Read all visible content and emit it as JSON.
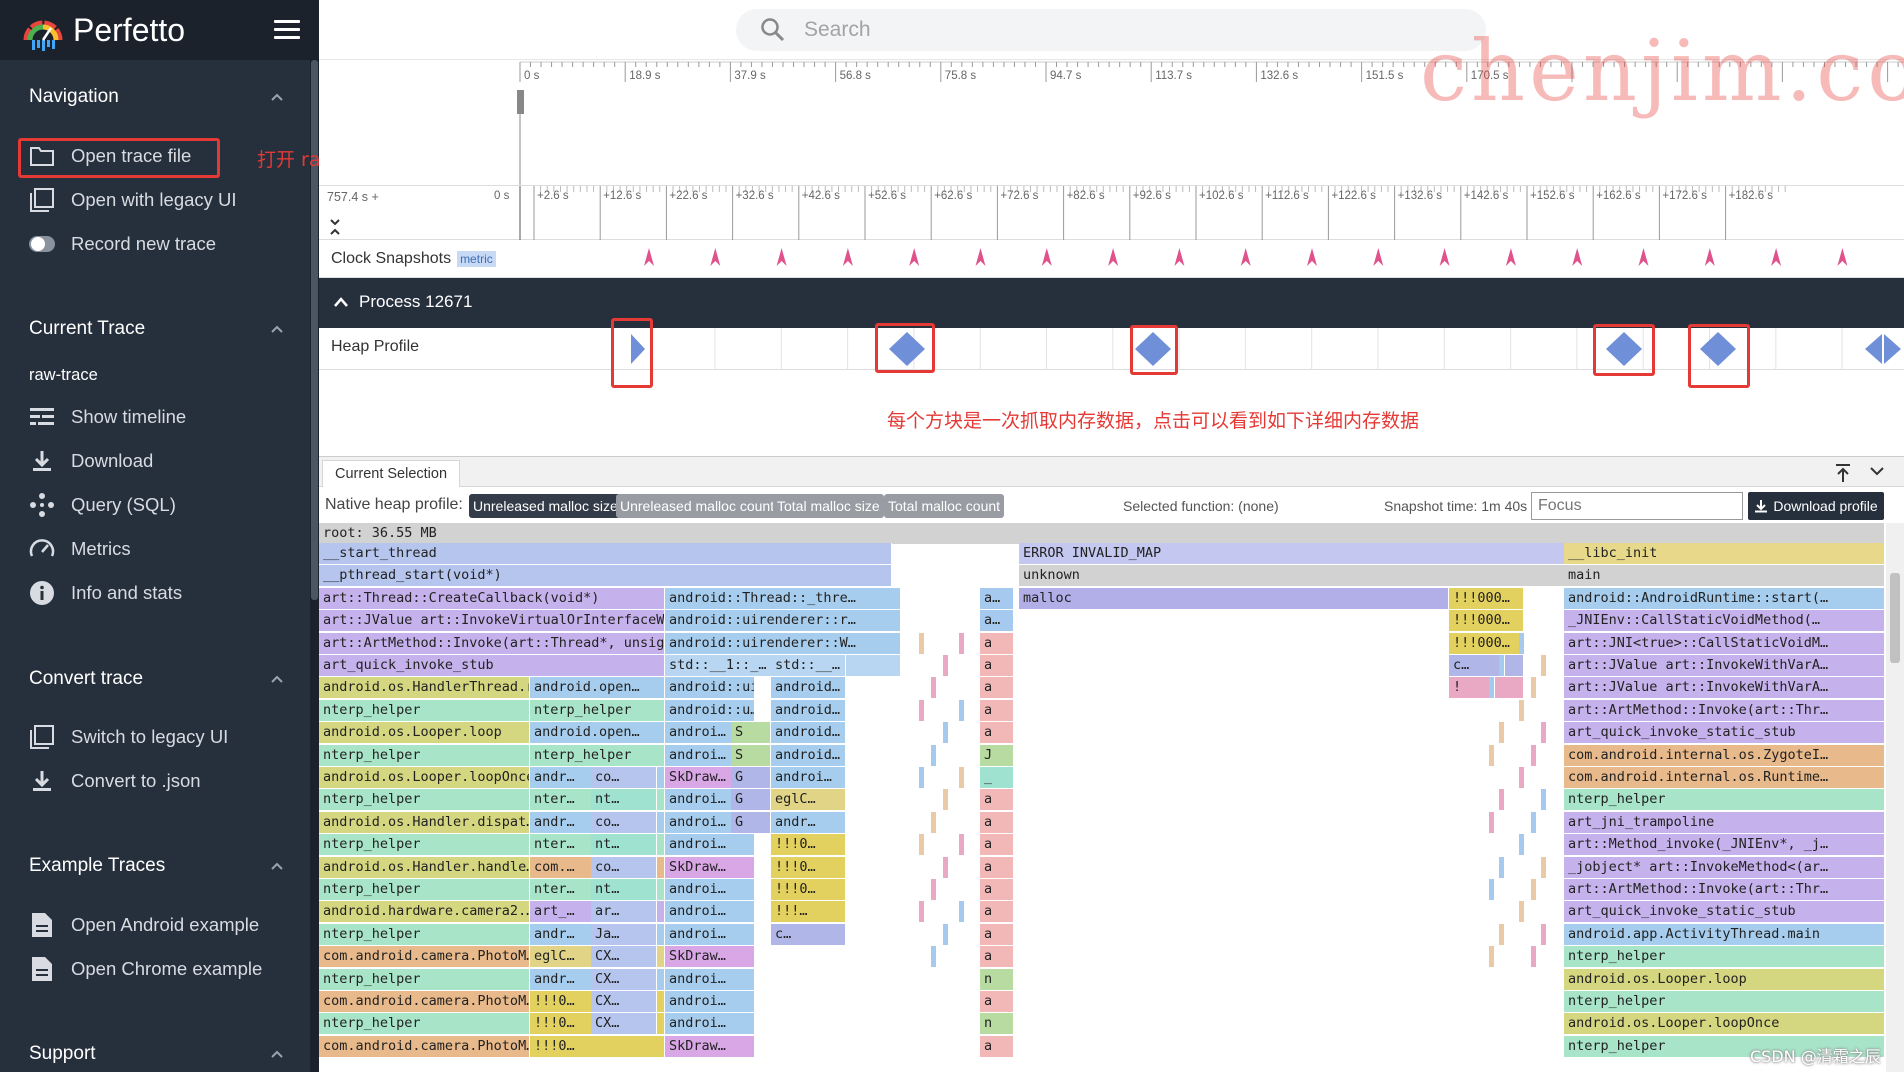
{
  "app": {
    "brand": "Perfetto"
  },
  "search": {
    "placeholder": "Search"
  },
  "watermark": "chenjim.com",
  "credit": "CSDN @清霜之辰",
  "sidebar": {
    "sections": [
      {
        "title": "Navigation",
        "items": [
          {
            "label": "Open trace file",
            "icon": "folder-icon"
          },
          {
            "label": "Open with legacy UI",
            "icon": "window-icon"
          },
          {
            "label": "Record new trace",
            "icon": "record-toggle-icon"
          }
        ]
      },
      {
        "title": "Current Trace",
        "trace_name": "raw-trace",
        "items": [
          {
            "label": "Show timeline",
            "icon": "timeline-icon"
          },
          {
            "label": "Download",
            "icon": "download-icon"
          },
          {
            "label": "Query (SQL)",
            "icon": "query-icon"
          },
          {
            "label": "Metrics",
            "icon": "speedometer-icon"
          },
          {
            "label": "Info and stats",
            "icon": "info-icon"
          }
        ]
      },
      {
        "title": "Convert trace",
        "items": [
          {
            "label": "Switch to legacy UI",
            "icon": "window-icon"
          },
          {
            "label": "Convert to .json",
            "icon": "download-icon"
          }
        ]
      },
      {
        "title": "Example Traces",
        "items": [
          {
            "label": "Open Android example",
            "icon": "document-icon"
          },
          {
            "label": "Open Chrome example",
            "icon": "document-icon"
          }
        ]
      },
      {
        "title": "Support",
        "items": []
      }
    ]
  },
  "annotations": {
    "open_trace_note": "打开 raw_trace 文件",
    "heap_note": "每个方块是一次抓取内存数据，点击可以看到如下详细内存数据"
  },
  "overview": {
    "ticks": [
      "0 s",
      "18.9 s",
      "37.9 s",
      "56.8 s",
      "75.8 s",
      "94.7 s",
      "113.7 s",
      "132.6 s",
      "151.5 s",
      "170.5 s"
    ]
  },
  "timebar": {
    "offset": "757.4 s +",
    "ticks": [
      "0 s",
      "+2.6 s",
      "+12.6 s",
      "+22.6 s",
      "+32.6 s",
      "+42.6 s",
      "+52.6 s",
      "+62.6 s",
      "+72.6 s",
      "+82.6 s",
      "+92.6 s",
      "+102.6 s",
      "+112.6 s",
      "+122.6 s",
      "+132.6 s",
      "+142.6 s",
      "+152.6 s",
      "+162.6 s",
      "+172.6 s",
      "+182.6 s"
    ]
  },
  "tracks": {
    "clock": {
      "label": "Clock Snapshots",
      "badge": "metric"
    },
    "process": {
      "title": "Process 12671"
    },
    "heap": {
      "label": "Heap Profile"
    }
  },
  "details": {
    "tab": "Current Selection",
    "native_label": "Native heap profile:",
    "modes": [
      {
        "label": "Unreleased malloc size",
        "active": true
      },
      {
        "label": "Unreleased malloc count",
        "active": false
      },
      {
        "label": "Total malloc size",
        "active": false
      },
      {
        "label": "Total malloc count",
        "active": false
      }
    ],
    "selected_function": "Selected function: (none)",
    "snapshot_time": "Snapshot time: 1m 40s",
    "focus_placeholder": "Focus",
    "download_label": "Download profile"
  },
  "flamegraph": {
    "root": "root: 36.55 MB",
    "col_a": [
      "__start_thread",
      "__pthread_start(void*)",
      "art::Thread::CreateCallback(void*)",
      "art::JValue art::InvokeVirtualOrInterfaceWit…",
      "art::ArtMethod::Invoke(art::Thread*, unsigne…",
      "art_quick_invoke_stub",
      "android.os.HandlerThread.run",
      "nterp_helper",
      "android.os.Looper.loop",
      "nterp_helper",
      "android.os.Looper.loopOnce",
      "nterp_helper",
      "android.os.Handler.dispat…",
      "nterp_helper",
      "android.os.Handler.handle…",
      "nterp_helper",
      "android.hardware.camera2.…",
      "nterp_helper",
      "com.android.camera.PhotoM…",
      "nterp_helper",
      "com.android.camera.PhotoM…",
      "nterp_helper",
      "com.android.camera.PhotoM…"
    ],
    "col_b": [
      "",
      "",
      "",
      "",
      "",
      "",
      "android.open…",
      "nterp_helper",
      "android.open…",
      "nterp_helper",
      "andr…",
      "nter…",
      "andr…",
      "nter…",
      "com.…",
      "nter…",
      "art_…",
      "andr…",
      "eglC…",
      "andr…",
      "!!!0…",
      "!!!0…",
      "!!!0…"
    ],
    "col_c": [
      "",
      "",
      "",
      "",
      "",
      "",
      "",
      "",
      "",
      "",
      "co…",
      "nt…",
      "co…",
      "nt…",
      "co…",
      "nt…",
      "ar…",
      "Ja…",
      "CX…",
      "CX…",
      "CX…",
      "CX…",
      ""
    ],
    "col_d": [
      "",
      "",
      "android::Thread::_thre…",
      "android::uirenderer::r…",
      "android::uirenderer::W…",
      "std::__1::_…",
      "android::ui…",
      "android::u…",
      "androi…",
      "androi…",
      "SkDraw…",
      "androi…",
      "androi…",
      "androi…",
      "SkDraw…",
      "androi…",
      "androi…",
      "androi…",
      "SkDraw…",
      "androi…",
      "androi…",
      "androi…",
      "SkDraw…"
    ],
    "col_e": [
      "",
      "",
      "",
      "",
      "",
      "std::__…",
      "android…",
      "android…",
      "android…",
      "android…",
      "androi…",
      "eglC…",
      "andr…",
      "!!!0…",
      "!!!0…",
      "!!!0…",
      "!!!…",
      "c…",
      "",
      "",
      "",
      "",
      ""
    ],
    "col_f": [
      "",
      "",
      "a…",
      "a…",
      "a",
      "a",
      "a",
      "a",
      "a",
      "J",
      "_",
      "a",
      "a",
      "a",
      "a",
      "a",
      "a",
      "a",
      "a",
      "n",
      "a",
      "n",
      "a"
    ],
    "col_g": [
      "ERROR INVALID_MAP",
      "unknown",
      "malloc"
    ],
    "col_h": [
      "",
      "",
      "!!!000…",
      "!!!000…",
      "!!!000…",
      "c…",
      "!"
    ],
    "col_i": [
      "__libc_init",
      "main",
      "android::AndroidRuntime::start(…",
      "_JNIEnv::CallStaticVoidMethod(…",
      "art::JNI<true>::CallStaticVoidM…",
      "art::JValue art::InvokeWithVarA…",
      "art::JValue art::InvokeWithVarA…",
      "art::ArtMethod::Invoke(art::Thr…",
      "art_quick_invoke_static_stub",
      "com.android.internal.os.ZygoteI…",
      "com.android.internal.os.Runtime…",
      "nterp_helper",
      "art_jni_trampoline",
      "art::Method_invoke(_JNIEnv*, _j…",
      "_jobject* art::InvokeMethod<(ar…",
      "art::ArtMethod::Invoke(art::Thr…",
      "art_quick_invoke_static_stub",
      "android.app.ActivityThread.main",
      "nterp_helper",
      "android.os.Looper.loop",
      "nterp_helper",
      "android.os.Looper.loopOnce",
      "nterp_helper"
    ],
    "extra_d2": [
      "",
      "",
      "",
      "",
      "",
      "",
      "",
      "",
      "S",
      "S",
      "G",
      "G",
      "G",
      "",
      "",
      "",
      "",
      "",
      "",
      "",
      "",
      "",
      ""
    ]
  },
  "colors": {
    "sidebar_bg": "#262f3c",
    "accent_red": "#e53935",
    "heap_diamond": "#6f8fd8",
    "snapshot_arrow": "#e0528b"
  }
}
